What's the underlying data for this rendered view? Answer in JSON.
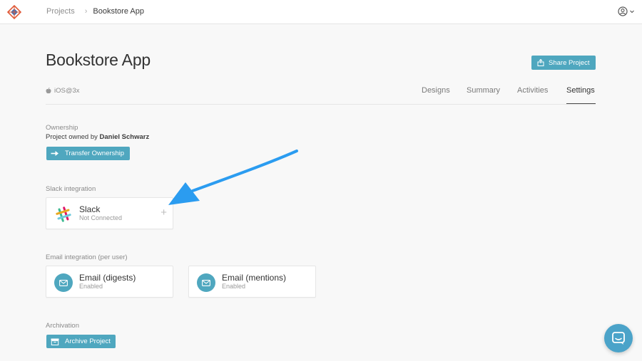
{
  "breadcrumb": {
    "projects": "Projects",
    "current": "Bookstore App"
  },
  "header": {
    "title": "Bookstore App",
    "share_label": "Share Project",
    "platform": "iOS@3x"
  },
  "tabs": [
    {
      "label": "Designs"
    },
    {
      "label": "Summary"
    },
    {
      "label": "Activities"
    },
    {
      "label": "Settings",
      "active": true
    }
  ],
  "ownership": {
    "label": "Ownership",
    "owner_prefix": "Project owned by",
    "owner_name": "Daniel Schwarz",
    "transfer_label": "Transfer Ownership"
  },
  "slack": {
    "section_label": "Slack integration",
    "title": "Slack",
    "status": "Not Connected"
  },
  "email": {
    "section_label": "Email integration (per user)",
    "cards": [
      {
        "title": "Email (digests)",
        "status": "Enabled"
      },
      {
        "title": "Email (mentions)",
        "status": "Enabled"
      }
    ]
  },
  "archivation": {
    "label": "Archivation",
    "button_label": "Archive Project"
  },
  "colors": {
    "accent": "#4fa7bf",
    "arrow": "#2b9cf0",
    "chat": "#4ba3c9"
  },
  "icons": {
    "logo": "logo-diamond-icon",
    "breadcrumb_separator": "chevron-right-icon",
    "user": "user-circle-icon",
    "share": "share-icon",
    "apple": "apple-icon",
    "transfer": "arrow-right-icon",
    "slack": "slack-icon",
    "plus": "plus-icon",
    "mail": "mail-icon",
    "archive": "archive-icon",
    "chat": "chat-icon"
  }
}
